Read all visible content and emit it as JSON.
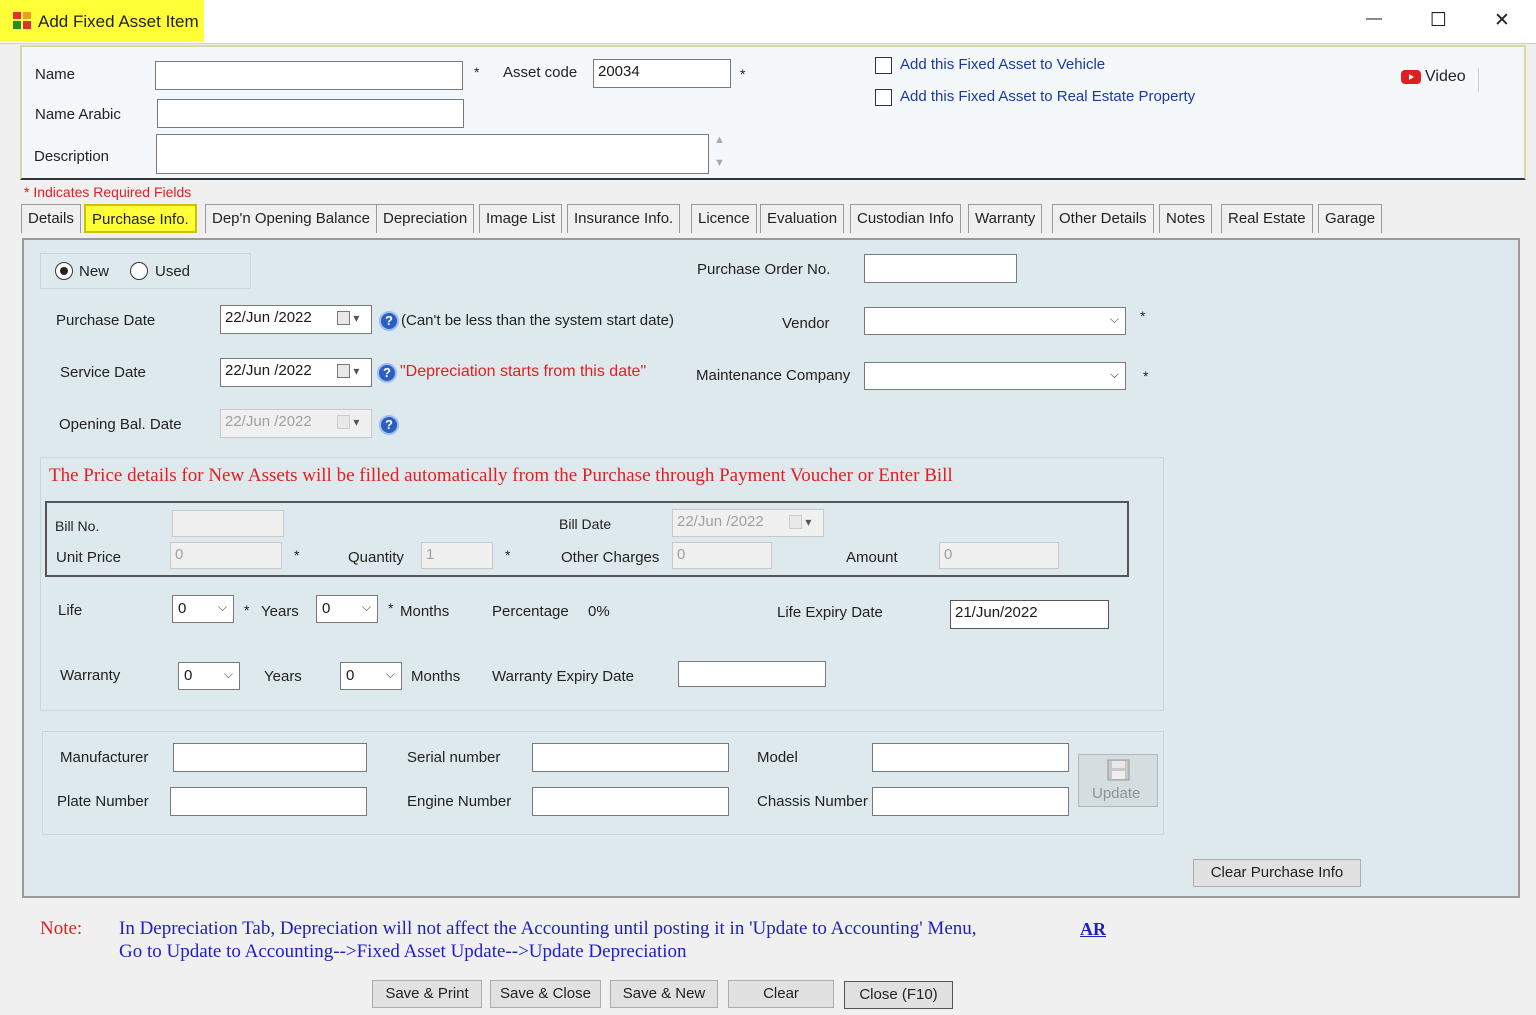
{
  "window": {
    "title": "Add Fixed Asset Item",
    "controls": {
      "minimize": "—",
      "maximize": "☐",
      "close": "✕"
    }
  },
  "header": {
    "name_label": "Name",
    "name_value": "",
    "asset_code_label": "Asset code",
    "asset_code_value": "20034",
    "name_arabic_label": "Name Arabic",
    "description_label": "Description",
    "required_star": "*",
    "add_vehicle_label": "Add this Fixed Asset to Vehicle",
    "add_real_estate_label": "Add this Fixed Asset to Real Estate Property",
    "video_label": "Video",
    "required_note": "* Indicates Required Fields"
  },
  "tabs": [
    {
      "label": "Details"
    },
    {
      "label": "Purchase Info."
    },
    {
      "label": "Dep'n Opening Balance"
    },
    {
      "label": "Depreciation"
    },
    {
      "label": "Image List"
    },
    {
      "label": "Insurance Info."
    },
    {
      "label": "Licence"
    },
    {
      "label": "Evaluation"
    },
    {
      "label": "Custodian Info"
    },
    {
      "label": "Warranty"
    },
    {
      "label": "Other Details"
    },
    {
      "label": "Notes"
    },
    {
      "label": "Real Estate"
    },
    {
      "label": "Garage"
    }
  ],
  "purchase": {
    "new_label": "New",
    "used_label": "Used",
    "purchase_order_label": "Purchase Order No.",
    "purchase_date_label": "Purchase Date",
    "purchase_date_value": "22/Jun /2022",
    "purchase_date_hint": "(Can't be less than the system start date)",
    "vendor_label": "Vendor",
    "service_date_label": "Service Date",
    "service_date_value": "22/Jun /2022",
    "service_date_hint": "\"Depreciation starts from this date\"",
    "maintenance_label": "Maintenance Company",
    "opening_bal_label": "Opening Bal. Date",
    "opening_bal_value": "22/Jun /2022",
    "price_note": "The Price details for New Assets will be filled automatically from the Purchase through Payment Voucher or Enter Bill",
    "bill_no_label": "Bill No.",
    "bill_date_label": "Bill Date",
    "bill_date_value": "22/Jun /2022",
    "unit_price_label": "Unit Price",
    "unit_price_value": "0",
    "quantity_label": "Quantity",
    "quantity_value": "1",
    "other_charges_label": "Other Charges",
    "other_charges_value": "0",
    "amount_label": "Amount",
    "amount_value": "0",
    "life_label": "Life",
    "life_years_value": "0",
    "years_label": "Years",
    "life_months_value": "0",
    "months_label": "Months",
    "percentage_label": "Percentage",
    "percentage_value": "0%",
    "life_expiry_label": "Life Expiry Date",
    "life_expiry_value": "21/Jun/2022",
    "warranty_label": "Warranty",
    "warranty_years_value": "0",
    "warranty_months_value": "0",
    "warranty_expiry_label": "Warranty Expiry Date",
    "manufacturer_label": "Manufacturer",
    "serial_label": "Serial number",
    "model_label": "Model",
    "plate_label": "Plate Number",
    "engine_label": "Engine Number",
    "chassis_label": "Chassis Number",
    "update_label": "Update",
    "clear_purchase_label": "Clear Purchase Info"
  },
  "note": {
    "label": "Note:",
    "line1": "In Depreciation Tab, Depreciation will not affect the Accounting until posting it in 'Update to Accounting' Menu,",
    "line2": "Go to Update to Accounting-->Fixed Asset Update-->Update Depreciation",
    "ar_link": "AR"
  },
  "footer": {
    "save_print": "Save & Print",
    "save_close": "Save & Close",
    "save_new": "Save & New",
    "clear": "Clear",
    "close": "Close (F10)"
  },
  "colors": {
    "highlight": "#ffff38",
    "required_red": "#e02020",
    "note_blue": "#2020c0",
    "panel_bg": "#dde9ed"
  }
}
